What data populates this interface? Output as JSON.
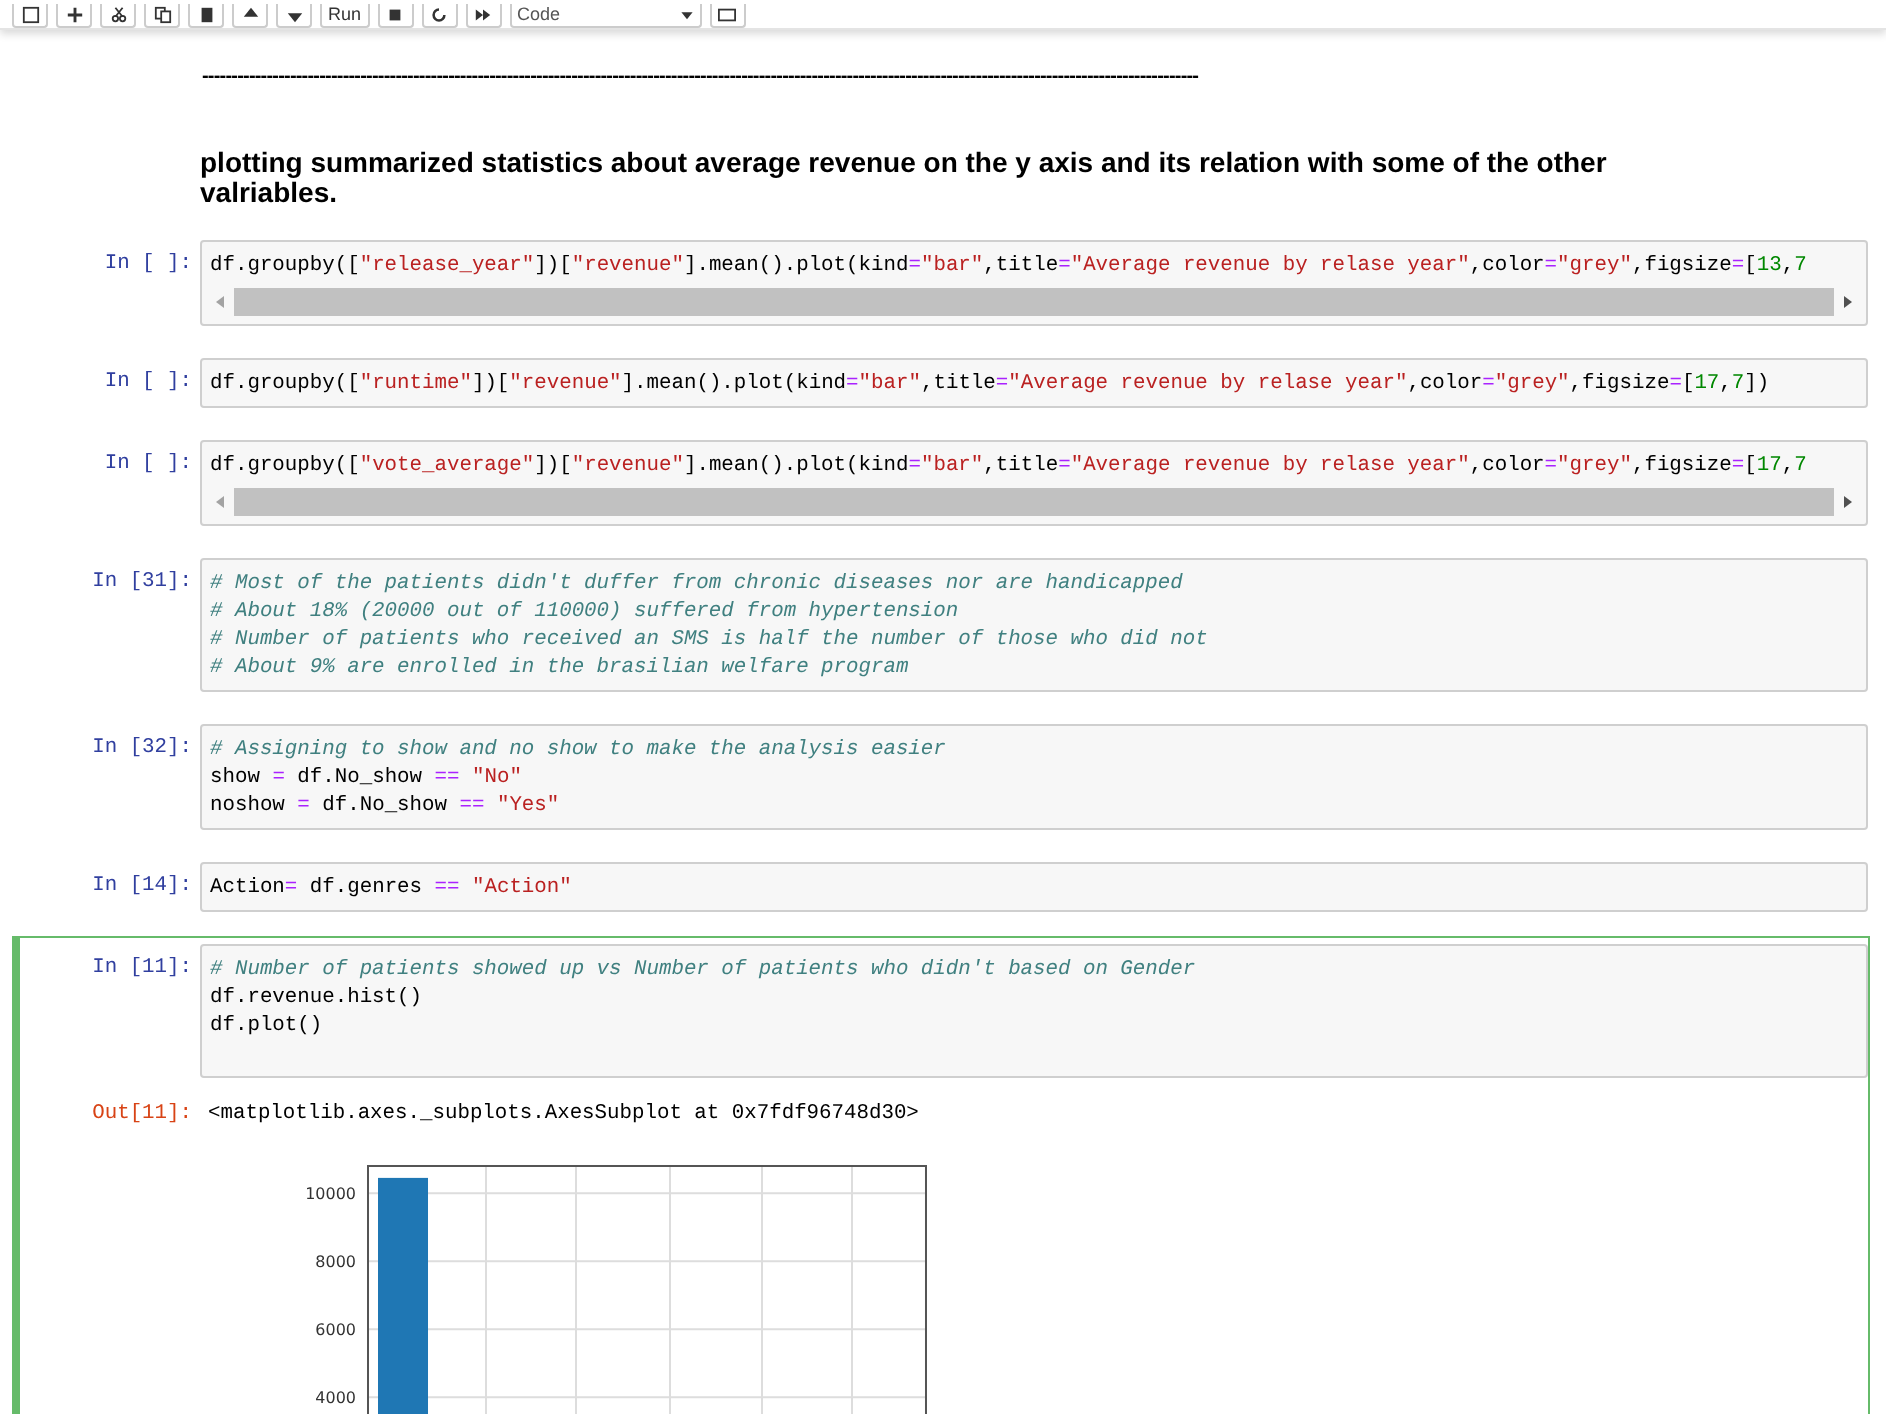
{
  "toolbar": {
    "run_label": "Run",
    "cell_type": "Code"
  },
  "markdown": {
    "rule": "--------------------------------------------------------------------------------------------------------------------------------------------------------------------------",
    "heading": "plotting summarized statistics about average revenue on the y axis and its relation with some of the other valriables."
  },
  "cells": [
    {
      "prompt": "In [ ]:",
      "selected": false,
      "scrollbar": true,
      "lines": [
        [
          {
            "text": "df.groupby([",
            "kind": "code"
          },
          {
            "text": "\"release_year\"",
            "kind": "string"
          },
          {
            "text": "])[",
            "kind": "code"
          },
          {
            "text": "\"revenue\"",
            "kind": "string"
          },
          {
            "text": "].mean().plot(kind",
            "kind": "code"
          },
          {
            "text": "=",
            "kind": "operator"
          },
          {
            "text": "\"bar\"",
            "kind": "string"
          },
          {
            "text": ",title",
            "kind": "code"
          },
          {
            "text": "=",
            "kind": "operator"
          },
          {
            "text": "\"Average revenue by relase year\"",
            "kind": "string"
          },
          {
            "text": ",color",
            "kind": "code"
          },
          {
            "text": "=",
            "kind": "operator"
          },
          {
            "text": "\"grey\"",
            "kind": "string"
          },
          {
            "text": ",figsize",
            "kind": "code"
          },
          {
            "text": "=",
            "kind": "operator"
          },
          {
            "text": "[",
            "kind": "code"
          },
          {
            "text": "13",
            "kind": "number"
          },
          {
            "text": ",",
            "kind": "code"
          },
          {
            "text": "7",
            "kind": "number"
          }
        ]
      ]
    },
    {
      "prompt": "In [ ]:",
      "selected": false,
      "scrollbar": false,
      "lines": [
        [
          {
            "text": "df.groupby([",
            "kind": "code"
          },
          {
            "text": "\"runtime\"",
            "kind": "string"
          },
          {
            "text": "])[",
            "kind": "code"
          },
          {
            "text": "\"revenue\"",
            "kind": "string"
          },
          {
            "text": "].mean().plot(kind",
            "kind": "code"
          },
          {
            "text": "=",
            "kind": "operator"
          },
          {
            "text": "\"bar\"",
            "kind": "string"
          },
          {
            "text": ",title",
            "kind": "code"
          },
          {
            "text": "=",
            "kind": "operator"
          },
          {
            "text": "\"Average revenue by relase year\"",
            "kind": "string"
          },
          {
            "text": ",color",
            "kind": "code"
          },
          {
            "text": "=",
            "kind": "operator"
          },
          {
            "text": "\"grey\"",
            "kind": "string"
          },
          {
            "text": ",figsize",
            "kind": "code"
          },
          {
            "text": "=",
            "kind": "operator"
          },
          {
            "text": "[",
            "kind": "code"
          },
          {
            "text": "17",
            "kind": "number"
          },
          {
            "text": ",",
            "kind": "code"
          },
          {
            "text": "7",
            "kind": "number"
          },
          {
            "text": "])",
            "kind": "code"
          }
        ]
      ]
    },
    {
      "prompt": "In [ ]:",
      "selected": false,
      "scrollbar": true,
      "lines": [
        [
          {
            "text": "df.groupby([",
            "kind": "code"
          },
          {
            "text": "\"vote_average\"",
            "kind": "string"
          },
          {
            "text": "])[",
            "kind": "code"
          },
          {
            "text": "\"revenue\"",
            "kind": "string"
          },
          {
            "text": "].mean().plot(kind",
            "kind": "code"
          },
          {
            "text": "=",
            "kind": "operator"
          },
          {
            "text": "\"bar\"",
            "kind": "string"
          },
          {
            "text": ",title",
            "kind": "code"
          },
          {
            "text": "=",
            "kind": "operator"
          },
          {
            "text": "\"Average revenue by relase year\"",
            "kind": "string"
          },
          {
            "text": ",color",
            "kind": "code"
          },
          {
            "text": "=",
            "kind": "operator"
          },
          {
            "text": "\"grey\"",
            "kind": "string"
          },
          {
            "text": ",figsize",
            "kind": "code"
          },
          {
            "text": "=",
            "kind": "operator"
          },
          {
            "text": "[",
            "kind": "code"
          },
          {
            "text": "17",
            "kind": "number"
          },
          {
            "text": ",",
            "kind": "code"
          },
          {
            "text": "7",
            "kind": "number"
          }
        ]
      ]
    },
    {
      "prompt": "In [31]:",
      "selected": false,
      "scrollbar": false,
      "lines": [
        [
          {
            "text": "# Most of the patients didn't duffer from chronic diseases nor are handicapped",
            "kind": "comment"
          }
        ],
        [
          {
            "text": "# About 18% (20000 out of 110000) suffered from hypertension",
            "kind": "comment"
          }
        ],
        [
          {
            "text": "# Number of patients who received an SMS is half the number of those who did not",
            "kind": "comment"
          }
        ],
        [
          {
            "text": "# About 9% are enrolled in the brasilian welfare program",
            "kind": "comment"
          }
        ]
      ]
    },
    {
      "prompt": "In [32]:",
      "selected": false,
      "scrollbar": false,
      "lines": [
        [
          {
            "text": "# Assigning to show and no show to make the analysis easier",
            "kind": "comment"
          }
        ],
        [
          {
            "text": "show ",
            "kind": "code"
          },
          {
            "text": "=",
            "kind": "operator"
          },
          {
            "text": " df.No_show ",
            "kind": "code"
          },
          {
            "text": "==",
            "kind": "operator"
          },
          {
            "text": " \"No\"",
            "kind": "string"
          }
        ],
        [
          {
            "text": "noshow ",
            "kind": "code"
          },
          {
            "text": "=",
            "kind": "operator"
          },
          {
            "text": " df.No_show ",
            "kind": "code"
          },
          {
            "text": "==",
            "kind": "operator"
          },
          {
            "text": " \"Yes\"",
            "kind": "string"
          }
        ]
      ]
    },
    {
      "prompt": "In [14]:",
      "selected": false,
      "scrollbar": false,
      "lines": [
        [
          {
            "text": "Action",
            "kind": "code"
          },
          {
            "text": "=",
            "kind": "operator"
          },
          {
            "text": " df.genres ",
            "kind": "code"
          },
          {
            "text": "==",
            "kind": "operator"
          },
          {
            "text": " \"Action\"",
            "kind": "string"
          }
        ]
      ]
    },
    {
      "prompt": "In [11]:",
      "selected": true,
      "scrollbar": false,
      "lines": [
        [
          {
            "text": "# Number of patients showed up vs Number of patients who didn't based on Gender",
            "kind": "comment"
          }
        ],
        [
          {
            "text": "df.revenue.hist()",
            "kind": "code"
          }
        ],
        [
          {
            "text": "df.plot()",
            "kind": "code"
          }
        ]
      ],
      "output": {
        "prompt": "Out[11]:",
        "text": "<matplotlib.axes._subplots.AxesSubplot at 0x7fdf96748d30>",
        "chart_data": {
          "type": "bar",
          "grid": true,
          "ylim": [
            0,
            10800
          ],
          "yticks": [
            4000,
            6000,
            8000,
            10000
          ],
          "series": [
            {
              "color": "#1f77b4",
              "values": [
                10450
              ]
            }
          ]
        }
      }
    }
  ]
}
